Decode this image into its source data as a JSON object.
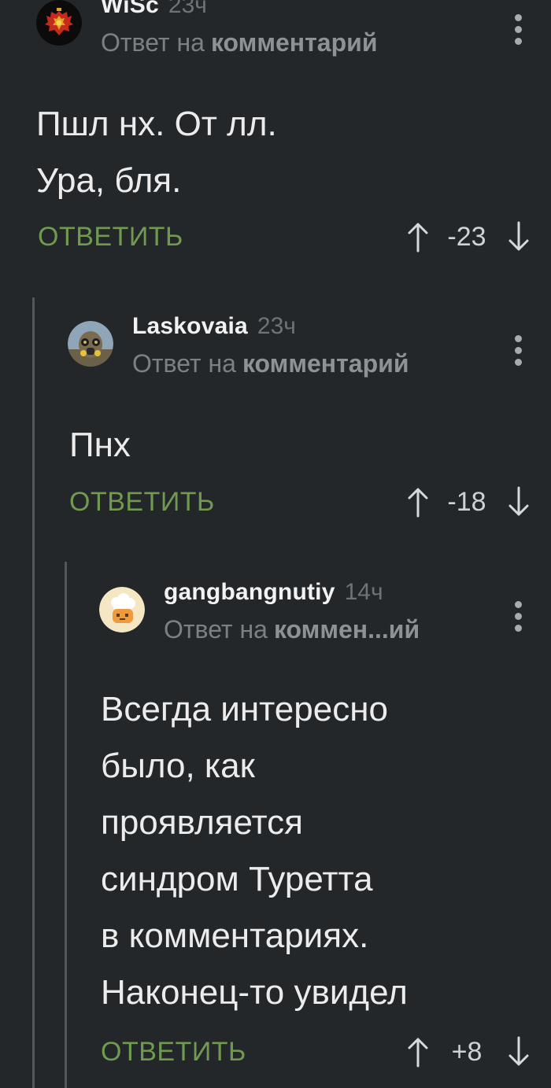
{
  "comments": [
    {
      "username": "WiSc",
      "time": "23ч",
      "reply_prefix": "Ответ на",
      "reply_link": "комментарий",
      "lines": [
        "Пшл нх. От лл.",
        "Ура, бля."
      ],
      "reply_label": "ОТВЕТИТЬ",
      "score": "-23"
    },
    {
      "username": "Laskovaia",
      "time": "23ч",
      "reply_prefix": "Ответ на",
      "reply_link": "комментарий",
      "lines": [
        "Пнх"
      ],
      "reply_label": "ОТВЕТИТЬ",
      "score": "-18"
    },
    {
      "username": "gangbangnutiy",
      "time": "14ч",
      "reply_prefix": "Ответ на",
      "reply_link": "коммен...ий",
      "lines": [
        "Всегда интересно",
        "было, как",
        "проявляется",
        "синдром Туретта",
        "в комментариях.",
        "Наконец-то увидел"
      ],
      "reply_label": "ОТВЕТИТЬ",
      "score": "+8"
    }
  ],
  "icons": {
    "upvote": "arrow-up-icon",
    "downvote": "arrow-down-icon",
    "menu": "more-vertical-icon"
  },
  "colors": {
    "background": "#24272a",
    "reply_green": "#6f9a50",
    "thread_line": "#53575b"
  }
}
